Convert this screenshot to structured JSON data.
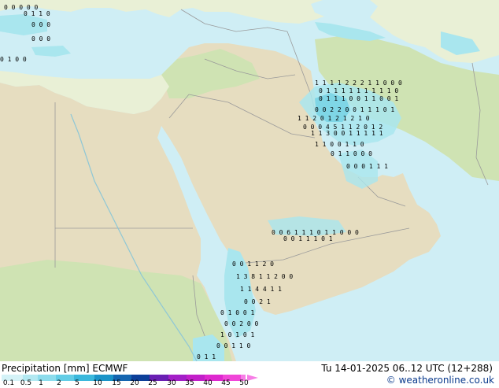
{
  "map": {
    "colors": {
      "sea": "#cfeef5",
      "land": "#e9f0d6",
      "land_green": "#cfe3b3",
      "desert": "#e6ddc0",
      "border": "#9a9a9a",
      "precip_light": "#a9e6ee",
      "precip_mid": "#7fd6e6",
      "digits": "#000000"
    },
    "digit_clusters": [
      {
        "text": "0 0 0 0 0"
      },
      {
        "text": "0 1 1 0"
      },
      {
        "text": "0 0 0"
      },
      {
        "text": "0 0 0"
      },
      {
        "text": "0 1 0 0"
      },
      {
        "text": "1 1 1 1 2 2 2 1 1 0 0 0"
      },
      {
        "text": "0 1 1 1 1 1 1 1 1 1 0"
      },
      {
        "text": "0 1 1 1 0 0 1 1 0 0 1"
      },
      {
        "text": "0 0 2 2 0 0 1 1 1 0 1"
      },
      {
        "text": "1 1 2 0 1 2 1 2 1 0"
      },
      {
        "text": "0 0 0 4 5 1 1 2 0 1 2"
      },
      {
        "text": "1 1 3 0 0 1 1 1 1 1"
      },
      {
        "text": "1 1 0 0 1 1 0"
      },
      {
        "text": "0 1 1 0 0 0"
      },
      {
        "text": "0 0 0 1 1 1"
      },
      {
        "text": "0 0 6 1 1 1 0 1 1 0 0 0"
      },
      {
        "text": "0 0 1 1 1 0 1"
      },
      {
        "text": "0 0 1 1 2 0"
      },
      {
        "text": "1 3 8 1 1 2 0 0"
      },
      {
        "text": "1 1 4 4 1 1"
      },
      {
        "text": "0 0 2 1"
      },
      {
        "text": "0 1 0 0 1"
      },
      {
        "text": "0 0 2 0 0"
      },
      {
        "text": "1 0 1 0 1"
      },
      {
        "text": "0 0 1 1 0"
      },
      {
        "text": "0 1 1"
      }
    ]
  },
  "legend": {
    "title": "Precipitation [mm]  ECMWF",
    "ticks": [
      "0.1",
      "0.5",
      "1",
      "2",
      "5",
      "10",
      "15",
      "20",
      "25",
      "30",
      "35",
      "40",
      "45",
      "50"
    ],
    "colors": [
      "#d4f2f7",
      "#b2e8f1",
      "#8cdcec",
      "#63cde6",
      "#3bb8dc",
      "#1a93c8",
      "#1465b0",
      "#0c3f99",
      "#6a1fb3",
      "#a31fc7",
      "#c21fc9",
      "#de28cf",
      "#f046d8",
      "#f77ee6"
    ]
  },
  "valid_time": "Tu 14-01-2025 06..12 UTC (12+288)",
  "credit": "© weatheronline.co.uk"
}
